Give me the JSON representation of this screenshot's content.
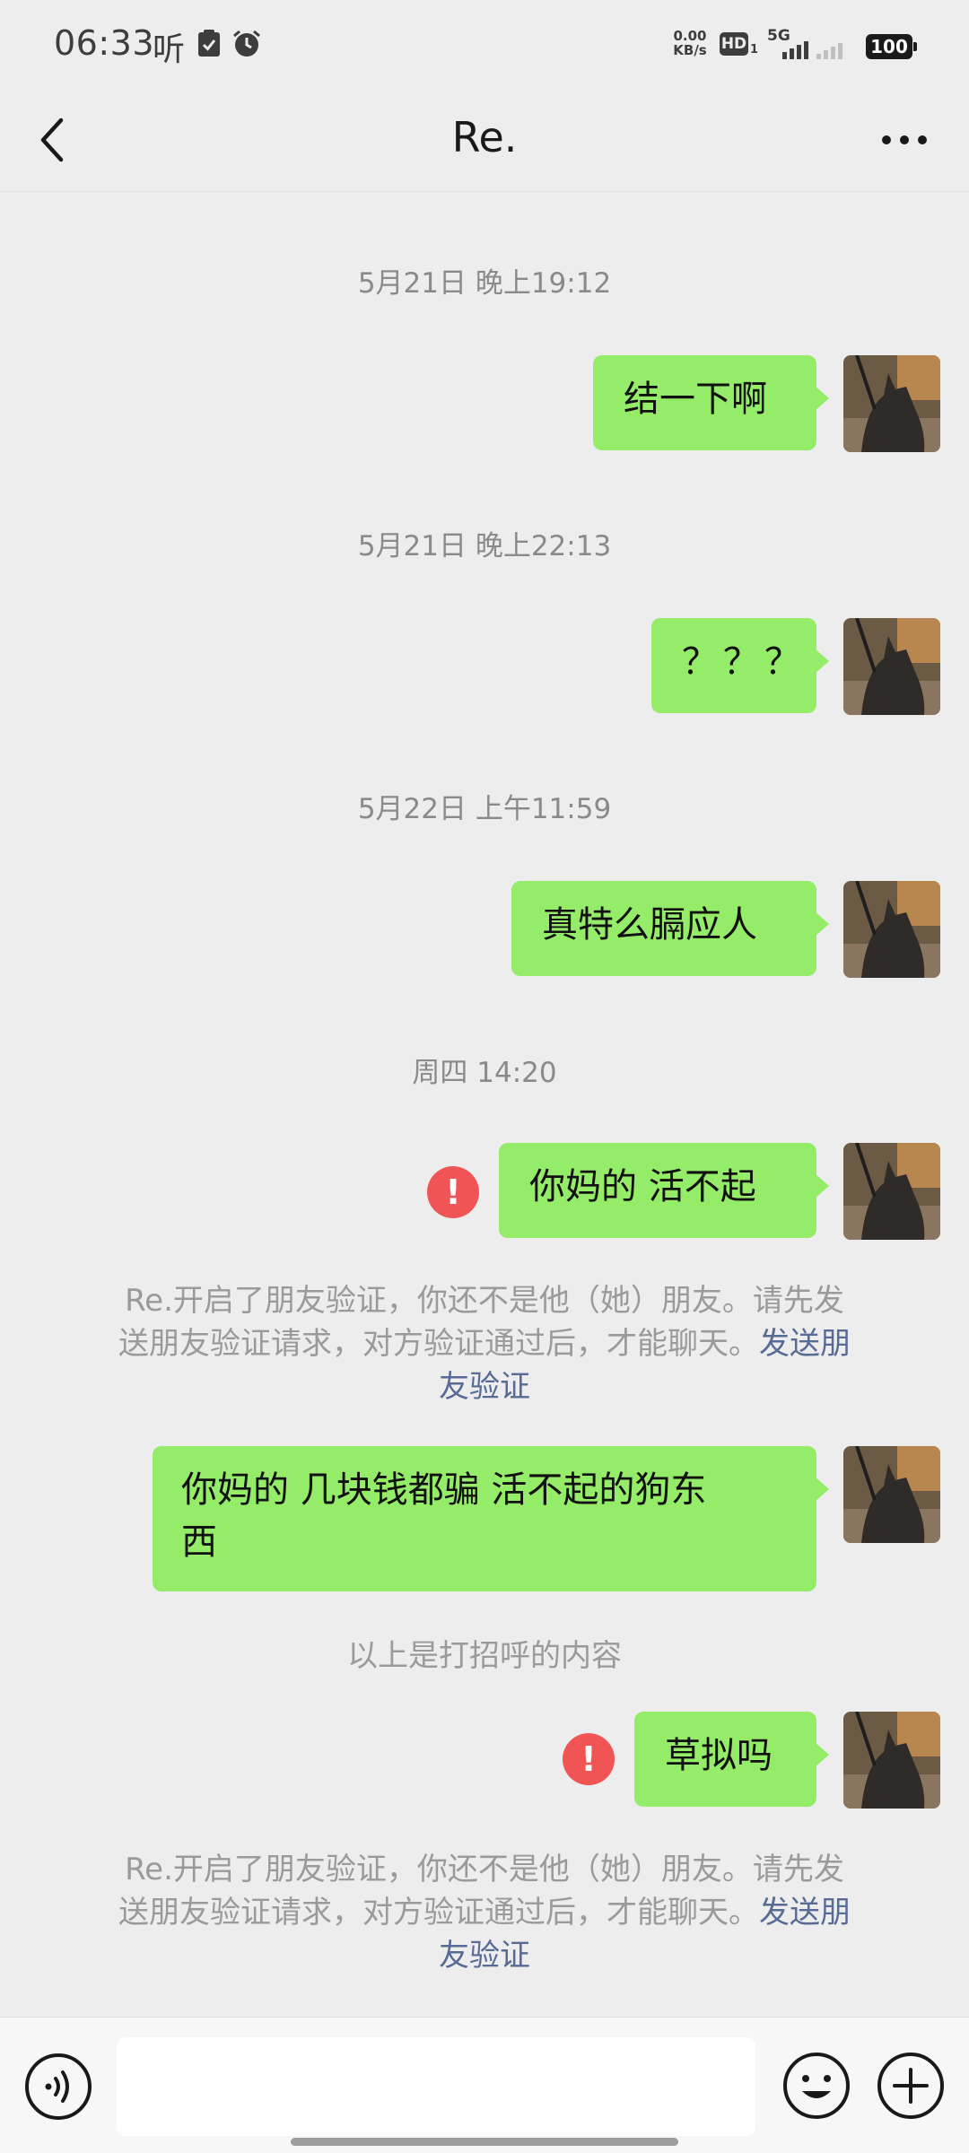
{
  "status_bar": {
    "time": "06:33",
    "listen_label": "听",
    "net_speed_value": "0.00",
    "net_speed_unit": "KB/s",
    "hd_label": "HD",
    "hd_sub": "1",
    "network_label": "5G",
    "battery_level": "100"
  },
  "nav": {
    "title": "Re."
  },
  "messages": [
    {
      "timestamp": "5月21日 晚上19:12",
      "text": "结一下啊",
      "failed": false
    },
    {
      "timestamp": "5月21日 晚上22:13",
      "text": "？？？",
      "failed": false
    },
    {
      "timestamp": "5月22日 上午11:59",
      "text": "真特么膈应人",
      "failed": false
    },
    {
      "timestamp": "周四 14:20",
      "text": "你妈的 活不起",
      "failed": true
    },
    {
      "text_line1": "你妈的 几块钱都骗 活不起的狗东",
      "text_line2": "西",
      "failed": false
    },
    {
      "text": "草拟吗",
      "failed": true
    }
  ],
  "system_notice": {
    "line1": "Re.开启了朋友验证，你还不是他（她）朋友。请先发",
    "line2_prefix": "送朋友验证请求，对方验证通过后，才能聊天。",
    "line2_link": "发送朋",
    "line3_link": "友验证"
  },
  "greeting_note": "以上是打招呼的内容",
  "error_mark": "!",
  "input_bar": {
    "placeholder": ""
  },
  "colors": {
    "bubble_green": "#95ec69",
    "error_red": "#f05454",
    "link_blue": "#576b95",
    "background": "#ededed"
  },
  "icons": [
    "back-arrow-icon",
    "more-icon",
    "voice-icon",
    "emoji-icon",
    "plus-icon",
    "cat-avatar"
  ]
}
